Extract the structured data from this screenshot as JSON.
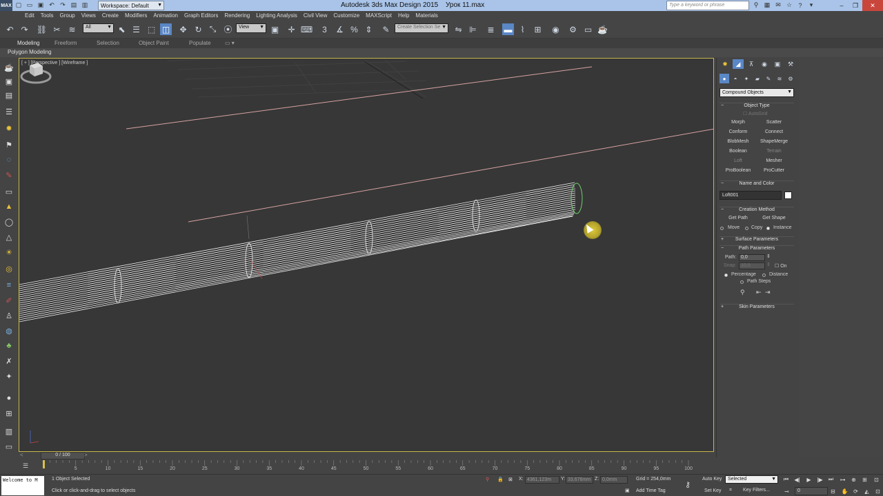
{
  "titlebar": {
    "logo": "MAX",
    "workspace": "Workspace: Default",
    "app_title": "Autodesk 3ds Max Design 2015",
    "doc_title": "Урок 11.max",
    "search_placeholder": "Type a keyword or phrase"
  },
  "menu": [
    "Edit",
    "Tools",
    "Group",
    "Views",
    "Create",
    "Modifiers",
    "Animation",
    "Graph Editors",
    "Rendering",
    "Lighting Analysis",
    "Civil View",
    "Customize",
    "MAXScript",
    "Help",
    "Materials"
  ],
  "toolbar": {
    "selection_filter": "All",
    "ref_coord": "View",
    "named_selection": "Create Selection Se"
  },
  "ribbon": {
    "tabs": [
      "Modeling",
      "Freeform",
      "Selection",
      "Object Paint",
      "Populate"
    ],
    "active_tab": "Modeling",
    "sub_label": "Polygon Modeling"
  },
  "viewport": {
    "label": "[ + ] [Perspective ] [Wireframe ]"
  },
  "command_panel": {
    "category": "Compound Objects",
    "object_type": {
      "title": "Object Type",
      "autogrid": "AutoGrid",
      "buttons": [
        "Morph",
        "Scatter",
        "Conform",
        "Connect",
        "BlobMesh",
        "ShapeMerge",
        "Boolean",
        "Terrain",
        "Loft",
        "Mesher",
        "ProBoolean",
        "ProCutter"
      ]
    },
    "name_color": {
      "title": "Name and Color",
      "name": "Loft001"
    },
    "creation_method": {
      "title": "Creation Method",
      "get_path": "Get Path",
      "get_shape": "Get Shape",
      "move": "Move",
      "copy": "Copy",
      "instance": "Instance"
    },
    "surface_parameters": "Surface Parameters",
    "path_parameters": {
      "title": "Path Parameters",
      "path_label": "Path:",
      "path_value": "0,0",
      "snap_label": "Snap:",
      "snap_value": "10,0",
      "on_label": "On",
      "percentage": "Percentage",
      "distance": "Distance",
      "path_steps": "Path Steps"
    },
    "skin_parameters": "Skin Parameters"
  },
  "timeline": {
    "slider_label": "0 / 100",
    "ticks": [
      0,
      5,
      10,
      15,
      20,
      25,
      30,
      35,
      40,
      45,
      50,
      55,
      60,
      65,
      70,
      75,
      80,
      85,
      90,
      95,
      100
    ]
  },
  "status": {
    "maxscript": "Welcome to M",
    "selection_info": "1 Object Selected",
    "prompt": "Click or click-and-drag to select objects",
    "x_label": "X:",
    "x_value": "4361,123m",
    "y_label": "Y:",
    "y_value": "33,676mm",
    "z_label": "Z:",
    "z_value": "0,0mm",
    "grid": "Grid = 254,0mm",
    "add_time_tag": "Add Time Tag",
    "auto_key": "Auto Key",
    "set_key": "Set Key",
    "selected": "Selected",
    "key_filters": "Key Filters...",
    "frame": "0"
  }
}
